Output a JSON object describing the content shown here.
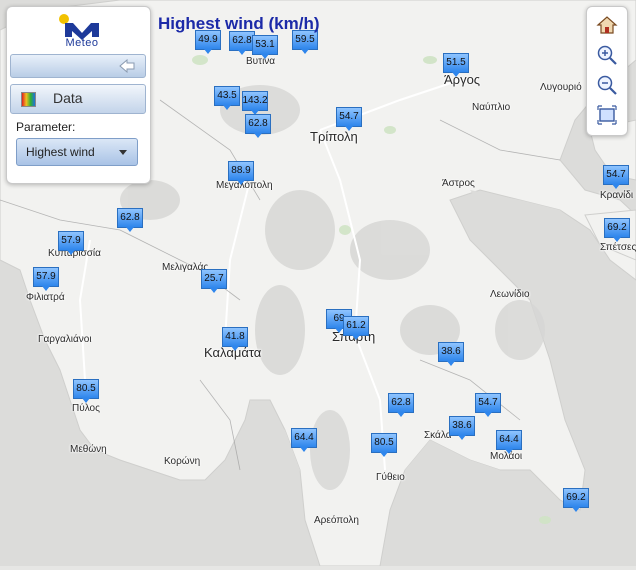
{
  "title": "Highest wind (km/h)",
  "panel": {
    "logo_text": "Meteo",
    "data_label": "Data",
    "parameter_label": "Parameter:",
    "parameter_value": "Highest wind"
  },
  "tools": [
    "home-icon",
    "zoom-in-icon",
    "zoom-out-icon",
    "extent-icon"
  ],
  "colors": {
    "marker_top": "#8fc4ff",
    "marker_bottom": "#2f86ec",
    "title": "#1c2aa8"
  },
  "places": [
    "Βυτινα",
    "Άργος",
    "Ναύπλιο",
    "Λυγουριό",
    "Τρίπολη",
    "Άστρος",
    "Μεγαλόπολη",
    "Κρανίδι",
    "Σπέτσες",
    "Κυπαρισσία",
    "Μελιγαλάς",
    "Λεωνίδιο",
    "Φιλιατρά",
    "Γαργαλιάνοι",
    "Καλαμάτα",
    "Σπάρτη",
    "Πύλος",
    "Σκάλα",
    "Μολάοι",
    "Μεθώνη",
    "Κορώνη",
    "Γύθειο",
    "Αρεόπολη"
  ],
  "stations": [
    {
      "value": "49.9"
    },
    {
      "value": "62.8"
    },
    {
      "value": "53.1"
    },
    {
      "value": "59.5"
    },
    {
      "value": "51.5"
    },
    {
      "value": "43.5"
    },
    {
      "value": "143.2"
    },
    {
      "value": "62.8"
    },
    {
      "value": "54.7"
    },
    {
      "value": "88.9"
    },
    {
      "value": "62.8"
    },
    {
      "value": "57.9"
    },
    {
      "value": "57.9"
    },
    {
      "value": "25.7"
    },
    {
      "value": "41.8"
    },
    {
      "value": "69"
    },
    {
      "value": "61.2"
    },
    {
      "value": "38.6"
    },
    {
      "value": "80.5"
    },
    {
      "value": "62.8"
    },
    {
      "value": "54.7"
    },
    {
      "value": "38.6"
    },
    {
      "value": "64.4"
    },
    {
      "value": "80.5"
    },
    {
      "value": "64.4"
    },
    {
      "value": "54.7"
    },
    {
      "value": "69.2"
    },
    {
      "value": "69.2"
    }
  ]
}
